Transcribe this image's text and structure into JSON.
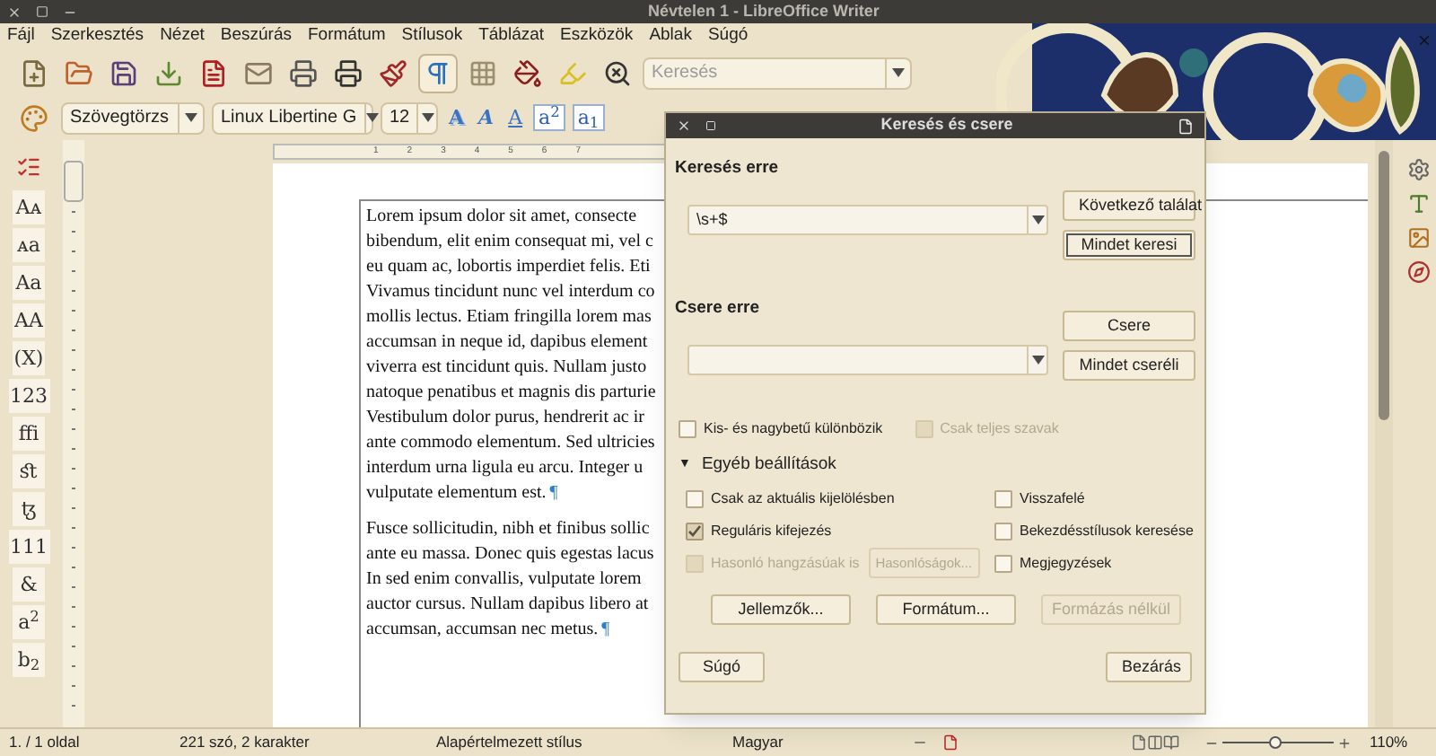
{
  "window": {
    "title": "Névtelen 1 - LibreOffice Writer"
  },
  "menu": [
    "Fájl",
    "Szerkesztés",
    "Nézet",
    "Beszúrás",
    "Formátum",
    "Stílusok",
    "Táblázat",
    "Eszközök",
    "Ablak",
    "Súgó"
  ],
  "toolbar": {
    "formatting_marks_on": true,
    "search": {
      "placeholder": "Keresés"
    }
  },
  "format_bar": {
    "style": "Szövegtörzs",
    "font": "Linux Libertine G",
    "size": "12",
    "text_buttons": [
      {
        "label": "A",
        "kind": "shadow"
      },
      {
        "label": "A",
        "kind": "outline"
      },
      {
        "label": "A",
        "kind": "underline"
      },
      {
        "label": "a$^{2}$",
        "kind": "boxed"
      },
      {
        "label": "a$_{1}$",
        "kind": "boxed"
      }
    ]
  },
  "font_features": [
    "Aᴀ",
    "ᴀa",
    "Aa",
    "AA",
    "(X)",
    "123",
    "ffi",
    "ﬆ",
    "ꜩ",
    "111",
    "&",
    "a$^{2}$",
    "b$_{2}$"
  ],
  "ruler": [
    "1",
    "2",
    "3",
    "4",
    "5",
    "6",
    "7"
  ],
  "document": {
    "paragraphs": [
      {
        "lines": [
          "Lorem ipsum dolor sit amet, consecte",
          "bibendum, elit enim consequat mi, vel c",
          "eu quam ac, lobortis imperdiet felis. Eti",
          "Vivamus tincidunt nunc vel interdum co",
          "mollis lectus. Etiam fringilla lorem mas",
          "accumsan in neque id, dapibus element",
          "viverra est tincidunt quis. Nullam justo",
          "natoque penatibus et magnis dis parturie",
          "Vestibulum dolor purus, hendrerit ac ir",
          "ante commodo elementum. Sed ultricies",
          "interdum urna ligula eu arcu. Integer u",
          "vulputate elementum est."
        ],
        "mark": "¶"
      },
      {
        "lines": [
          "Fusce sollicitudin, nibh et finibus sollic",
          "ante eu massa. Donec quis egestas lacus",
          "In sed enim convallis, vulputate lorem",
          "auctor cursus. Nullam dapibus libero at",
          "accumsan, accumsan nec metus."
        ],
        "mark": "¶"
      }
    ]
  },
  "dialog": {
    "title": "Keresés és csere",
    "search_label": "Keresés erre",
    "search_value": "\\s+$",
    "search_buttons": [
      {
        "label": "Következő találat",
        "focused": false
      },
      {
        "label": "Mindet keresi",
        "focused": true
      }
    ],
    "replace_label": "Csere erre",
    "replace_buttons": [
      {
        "label": "Csere",
        "focused": false
      },
      {
        "label": "Mindet cseréli",
        "focused": false
      }
    ],
    "main_options": [
      {
        "label": "Kis- és nagybetű különbözik",
        "checked": false,
        "disabled": false
      },
      {
        "label": "Csak teljes szavak",
        "checked": false,
        "disabled": true
      }
    ],
    "expander": {
      "label": "Egyéb beállítások",
      "arrow": "▼",
      "expanded": true
    },
    "left_options": [
      {
        "label": "Csak az aktuális kijelölésben",
        "checked": false,
        "disabled": false
      },
      {
        "label": "Reguláris kifejezés",
        "checked": true,
        "disabled": false
      },
      {
        "label": "Hasonló hangzásúak is",
        "checked": false,
        "disabled": true,
        "button": {
          "label": "Hasonlóságok...",
          "disabled": true
        }
      }
    ],
    "right_options": [
      {
        "label": "Visszafelé",
        "checked": false,
        "disabled": false
      },
      {
        "label": "Bekezdésstílusok keresése",
        "checked": false,
        "disabled": false
      },
      {
        "label": "Megjegyzések",
        "checked": false,
        "disabled": false
      }
    ],
    "attribute_buttons": [
      {
        "label": "Jellemzők...",
        "disabled": false
      },
      {
        "label": "Formátum...",
        "disabled": false
      },
      {
        "label": "Formázás nélkül",
        "disabled": true
      }
    ],
    "help_button": "Súgó",
    "close_button": "Bezárás"
  },
  "status_bar": {
    "page": "1. / 1 oldal",
    "words": "221 szó, 2 karakter",
    "style": "Alapértelmezett stílus",
    "language": "Magyar",
    "zoom": {
      "level": 0.47,
      "reading": "110%"
    }
  }
}
